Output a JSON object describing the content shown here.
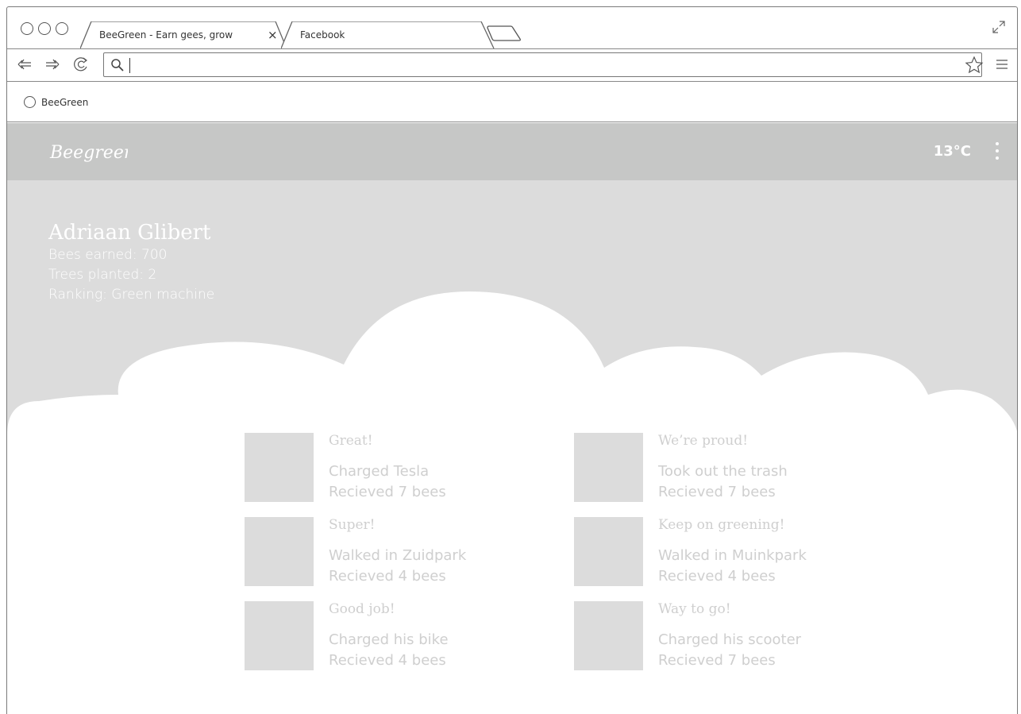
{
  "browser": {
    "tabs": [
      {
        "label": "BeeGreen - Earn gees, grow",
        "active": true
      },
      {
        "label": "Facebook",
        "active": false
      }
    ],
    "close_glyph": "×",
    "address": {
      "value": "",
      "placeholder": ""
    },
    "bookmarks": [
      {
        "label": "BeeGreen"
      }
    ],
    "icons": {
      "back": "back-arrow-icon",
      "forward": "forward-arrow-icon",
      "reload": "reload-icon",
      "search": "magnifier-icon",
      "star": "star-icon",
      "menu": "hamburger-menu-icon",
      "expand": "expand-window-icon"
    }
  },
  "app": {
    "logo_text": "Beegreen",
    "temperature": "13°C",
    "colors": {
      "appbar": "#c6c7c6",
      "hero": "#dcdcdc",
      "cloud": "#ffffff",
      "muted_text": "#cfcfcf"
    }
  },
  "profile": {
    "name": "Adriaan Glibert",
    "bees_earned": "Bees earned: 700",
    "trees_planted": "Trees planted: 2",
    "ranking": "Ranking: Green machine"
  },
  "feed": [
    {
      "headline": "Great!",
      "activity": "Charged Tesla",
      "reward": "Recieved 7 bees"
    },
    {
      "headline": "We’re proud!",
      "activity": "Took out the trash",
      "reward": "Recieved 7 bees"
    },
    {
      "headline": "Super!",
      "activity": "Walked in Zuidpark",
      "reward": "Recieved 4 bees"
    },
    {
      "headline": "Keep on greening!",
      "activity": "Walked in Muinkpark",
      "reward": "Recieved 4 bees"
    },
    {
      "headline": "Good job!",
      "activity": "Charged his bike",
      "reward": "Recieved 4 bees"
    },
    {
      "headline": "Way to go!",
      "activity": "Charged his scooter",
      "reward": "Recieved 7 bees"
    }
  ]
}
